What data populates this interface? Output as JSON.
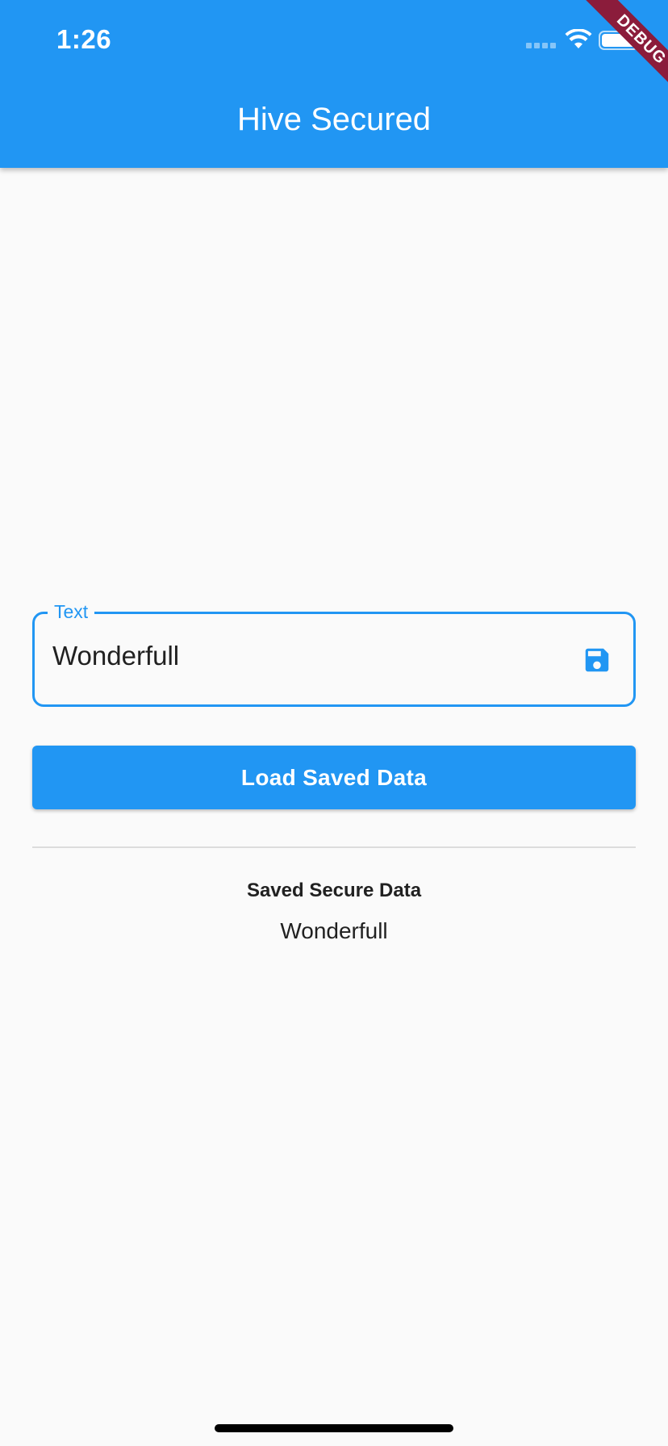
{
  "status_bar": {
    "time": "1:26"
  },
  "debug_banner": "DEBUG",
  "app_bar": {
    "title": "Hive Secured",
    "color": "#2196f3"
  },
  "text_field": {
    "label": "Text",
    "value": "Wonderfull",
    "suffix_icon": "save-icon"
  },
  "load_button": {
    "label": "Load Saved Data"
  },
  "saved_section": {
    "heading": "Saved Secure Data",
    "value": "Wonderfull"
  }
}
